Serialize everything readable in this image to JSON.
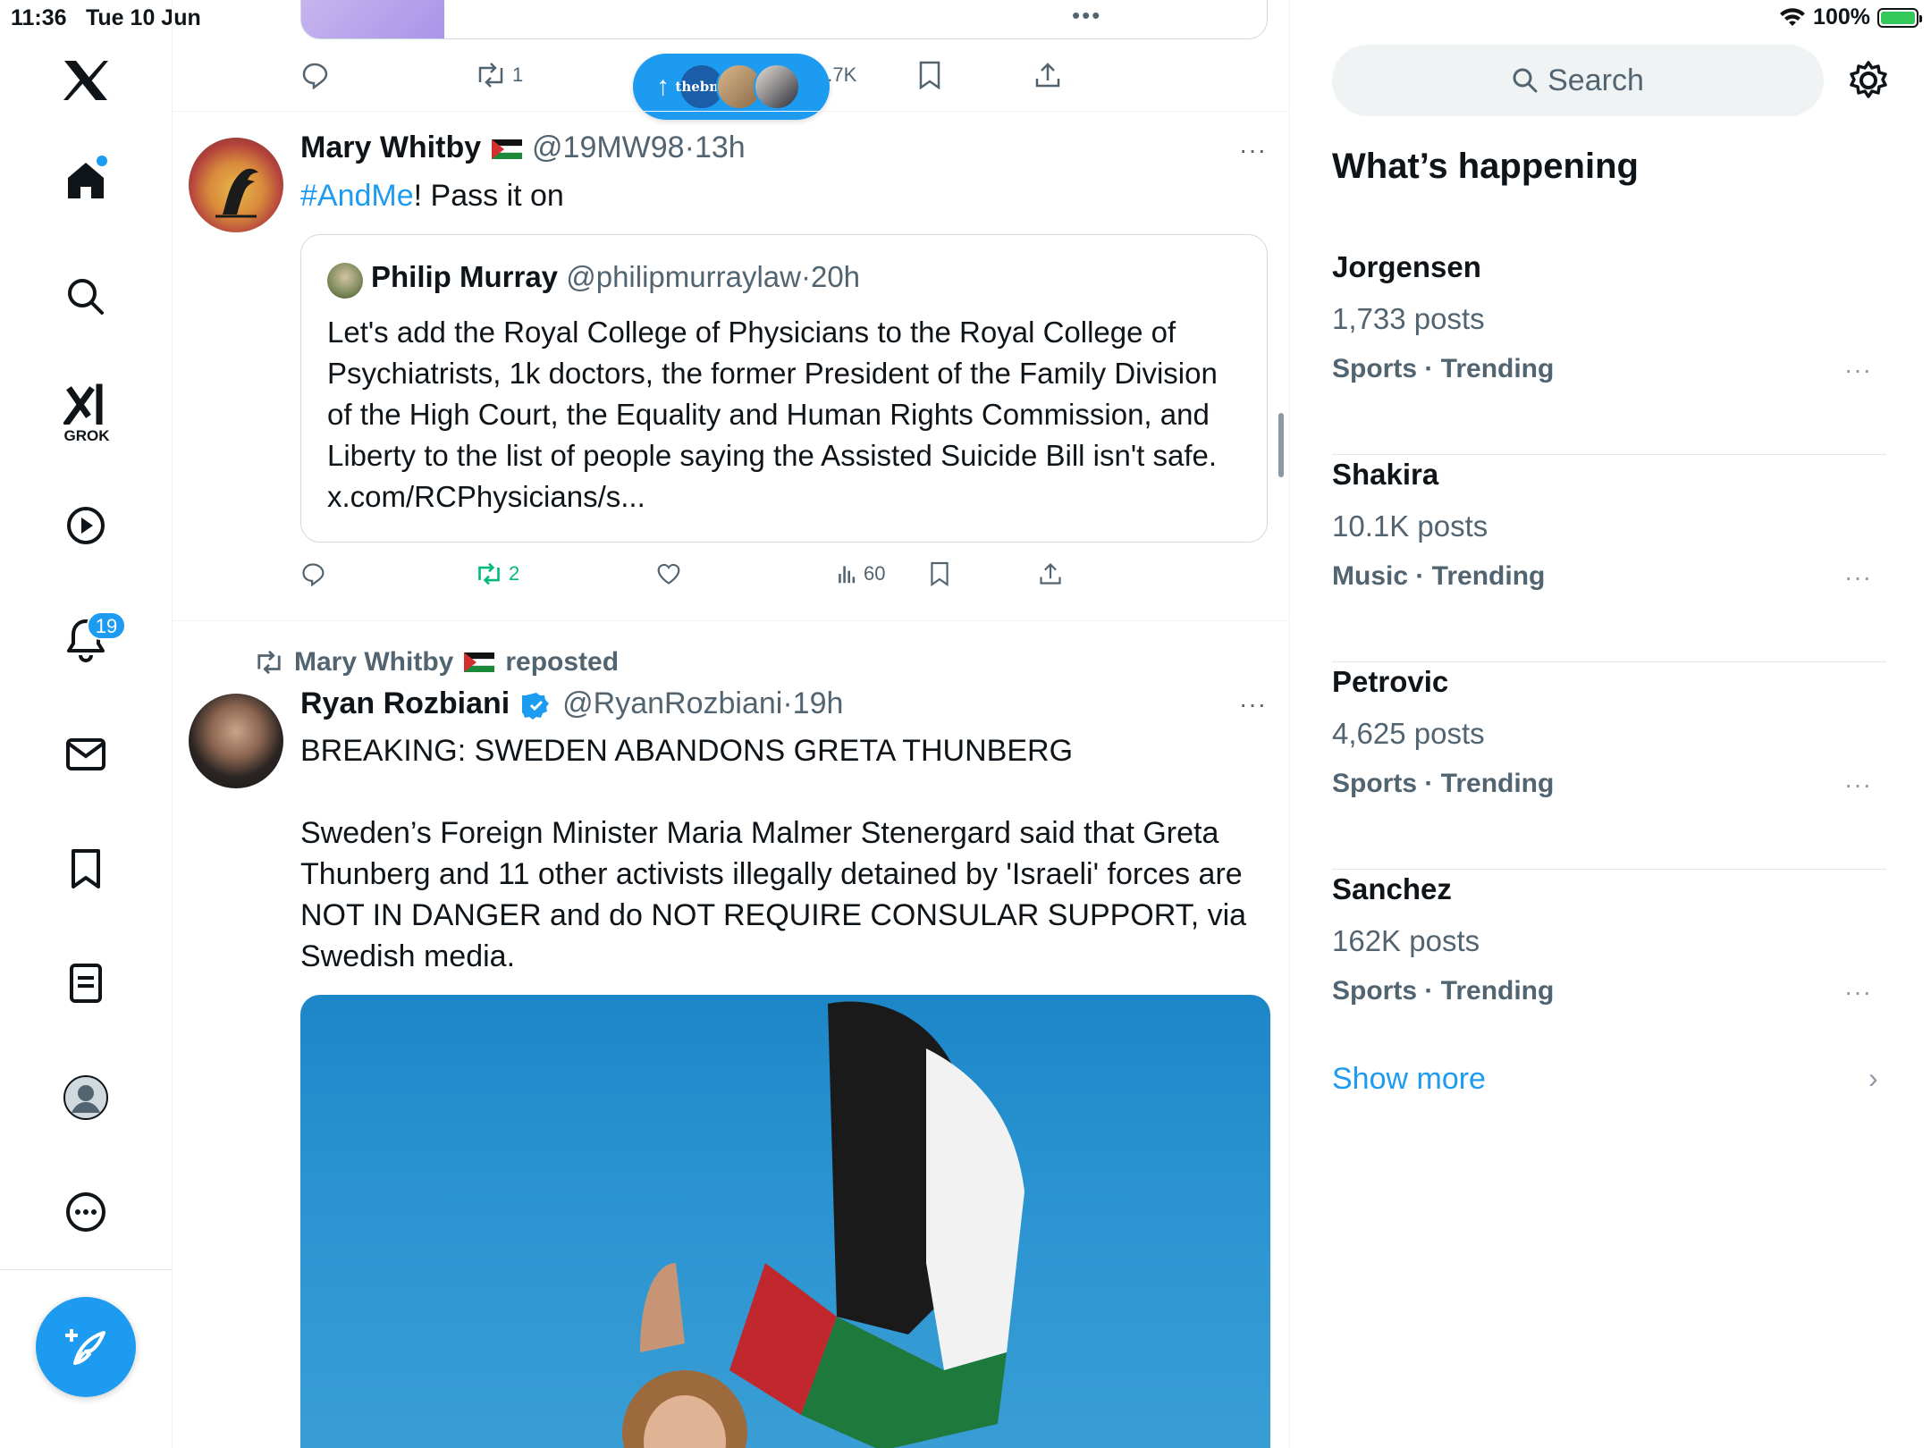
{
  "status": {
    "time": "11:36",
    "date": "Tue 10 Jun",
    "battery": "100%",
    "battery_level": 1.0
  },
  "nav": {
    "grok_label": "GROK",
    "notifications_badge": "19",
    "compose_icon": "compose-feather-icon"
  },
  "feed": {
    "previous_post": {
      "stats": {
        "reposts": "1",
        "views": "1.7K"
      }
    },
    "new_posts_pill": {
      "arrow": "↑",
      "avatar_label": "thebmj"
    },
    "post1": {
      "name": "Mary Whitby",
      "handle": "@19MW98",
      "time": "13h",
      "hashtag": "#AndMe",
      "text_after_hashtag": "! Pass it on",
      "more": "···",
      "quote": {
        "name": "Philip Murray",
        "handle": "@philipmurraylaw",
        "time": "20h",
        "text": "Let's add the Royal College of Physicians to the Royal College of Psychiatrists, 1k doctors, the former President of the Family Division of the High Court, the Equality and Human Rights Commission, and Liberty to the list of people saying the Assisted Suicide Bill isn't safe. x.com/RCPhysicians/s..."
      },
      "stats": {
        "reposts": "2",
        "views": "60"
      }
    },
    "post2": {
      "repost_by": "Mary Whitby",
      "repost_suffix": "reposted",
      "name": "Ryan Rozbiani",
      "handle": "@RyanRozbiani",
      "time": "19h",
      "more": "···",
      "text": "BREAKING: SWEDEN ABANDONS GRETA THUNBERG\n\nSweden’s Foreign Minister Maria Malmer Stenergard said that Greta Thunberg and 11 other activists illegally detained by 'Israeli' forces are NOT IN DANGER and do NOT REQUIRE CONSULAR SUPPORT, via Swedish media."
    }
  },
  "sidebar": {
    "search_placeholder": "Search",
    "title": "What’s happening",
    "trends": [
      {
        "name": "Jorgensen",
        "posts": "1,733 posts",
        "category": "Sports · Trending"
      },
      {
        "name": "Shakira",
        "posts": "10.1K posts",
        "category": "Music · Trending"
      },
      {
        "name": "Petrovic",
        "posts": "4,625 posts",
        "category": "Sports · Trending"
      },
      {
        "name": "Sanchez",
        "posts": "162K posts",
        "category": "Sports · Trending"
      }
    ],
    "trend_more": "···",
    "show_more": "Show more",
    "show_more_chevron": "›"
  },
  "colors": {
    "accent": "#1d9bf0",
    "text": "#0f1419",
    "muted": "#536471",
    "repost_green": "#00ba7c"
  }
}
